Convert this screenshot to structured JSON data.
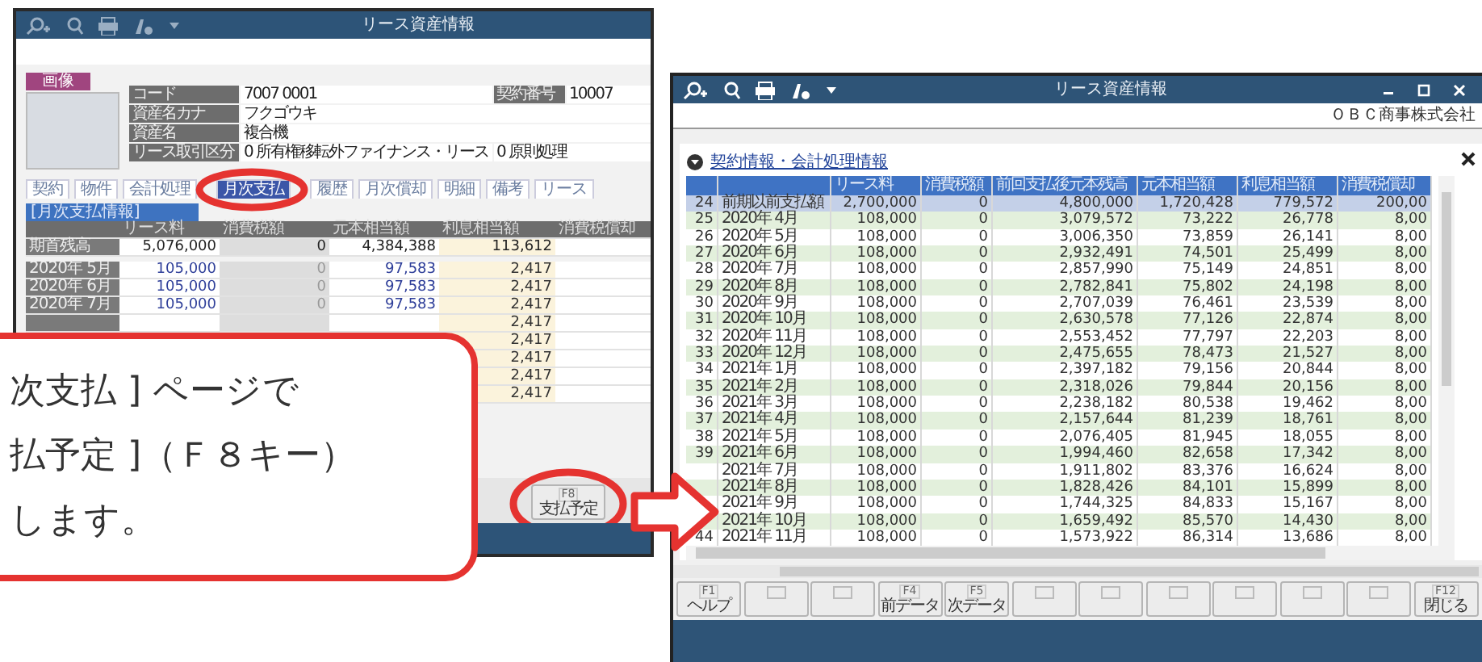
{
  "back_window": {
    "title": "リース資産情報",
    "photo_tag": "画像",
    "fields": [
      {
        "label": "コード",
        "value": "7007 0001"
      },
      {
        "label": "契約番号",
        "value": "10007"
      },
      {
        "label": "資産名カナ",
        "value": "フクゴウキ"
      },
      {
        "label": "資産名",
        "value": "複合機"
      },
      {
        "label": "リース取引区分",
        "value": "0 所有権移転外ファイナンス・リース"
      },
      {
        "value": "0 原則処理"
      }
    ],
    "tabs": [
      {
        "label": "契約",
        "selected": false
      },
      {
        "label": "物件",
        "selected": false
      },
      {
        "label": "会計処理",
        "selected": false
      },
      {
        "label": "月次支払",
        "selected": true
      },
      {
        "label": "履歴",
        "selected": false
      },
      {
        "label": "月次償却",
        "selected": false
      },
      {
        "label": "明細",
        "selected": false
      },
      {
        "label": "備考",
        "selected": false
      },
      {
        "label": "リース",
        "selected": false
      }
    ],
    "section": "[月次支払情報]",
    "table": {
      "columns": [
        "リース料",
        "消費税額",
        "元本相当額",
        "利息相当額",
        "消費税償却"
      ],
      "opening": {
        "label": "期首残高",
        "cells": [
          "5,076,000",
          "0",
          "4,384,388",
          "113,612"
        ]
      },
      "rows": [
        {
          "label": "2020年 5月",
          "cells": [
            "105,000",
            "0",
            "97,583",
            "2,417"
          ]
        },
        {
          "label": "2020年 6月",
          "cells": [
            "105,000",
            "0",
            "97,583",
            "2,417"
          ]
        },
        {
          "label": "2020年 7月",
          "cells": [
            "105,000",
            "0",
            "97,583",
            "2,417"
          ]
        },
        {
          "cells": [
            "2,417"
          ]
        },
        {
          "cells": [
            "2,417"
          ]
        },
        {
          "cells": [
            "2,417"
          ]
        },
        {
          "cells": [
            "2,417"
          ]
        },
        {
          "cells": [
            "2,417"
          ]
        }
      ]
    },
    "function_key": {
      "kind": "key",
      "key": "F8",
      "label": "支払予定"
    }
  },
  "front_window": {
    "title": "リース資産情報",
    "company": "ＯＢＣ商事株式会社",
    "section": "契約情報・会計処理情報",
    "table": {
      "columns": [
        "リース料",
        "消費税額",
        "前回支払後元本残高",
        "元本相当額",
        "利息相当額",
        "消費税償却"
      ],
      "rows": [
        {
          "number": "24",
          "label": "前期以前支払額",
          "cells": [
            "2,700,000",
            "0",
            "4,800,000",
            "1,720,428",
            "779,572",
            "200,00"
          ],
          "selected": true
        },
        {
          "number": "25",
          "label": "2020年 4月",
          "cells": [
            "108,000",
            "0",
            "3,079,572",
            "73,222",
            "26,778",
            "8,00"
          ],
          "selected": false
        },
        {
          "number": "26",
          "label": "2020年 5月",
          "cells": [
            "108,000",
            "0",
            "3,006,350",
            "73,859",
            "26,141",
            "8,00"
          ],
          "selected": false
        },
        {
          "number": "27",
          "label": "2020年 6月",
          "cells": [
            "108,000",
            "0",
            "2,932,491",
            "74,501",
            "25,499",
            "8,00"
          ],
          "selected": false
        },
        {
          "number": "28",
          "label": "2020年 7月",
          "cells": [
            "108,000",
            "0",
            "2,857,990",
            "75,149",
            "24,851",
            "8,00"
          ],
          "selected": false
        },
        {
          "number": "29",
          "label": "2020年 8月",
          "cells": [
            "108,000",
            "0",
            "2,782,841",
            "75,802",
            "24,198",
            "8,00"
          ],
          "selected": false
        },
        {
          "number": "30",
          "label": "2020年 9月",
          "cells": [
            "108,000",
            "0",
            "2,707,039",
            "76,461",
            "23,539",
            "8,00"
          ],
          "selected": false
        },
        {
          "number": "31",
          "label": "2020年 10月",
          "cells": [
            "108,000",
            "0",
            "2,630,578",
            "77,126",
            "22,874",
            "8,00"
          ],
          "selected": false
        },
        {
          "number": "32",
          "label": "2020年 11月",
          "cells": [
            "108,000",
            "0",
            "2,553,452",
            "77,797",
            "22,203",
            "8,00"
          ],
          "selected": false
        },
        {
          "number": "33",
          "label": "2020年 12月",
          "cells": [
            "108,000",
            "0",
            "2,475,655",
            "78,473",
            "21,527",
            "8,00"
          ],
          "selected": false
        },
        {
          "number": "34",
          "label": "2021年 1月",
          "cells": [
            "108,000",
            "0",
            "2,397,182",
            "79,156",
            "20,844",
            "8,00"
          ],
          "selected": false
        },
        {
          "number": "35",
          "label": "2021年 2月",
          "cells": [
            "108,000",
            "0",
            "2,318,026",
            "79,844",
            "20,156",
            "8,00"
          ],
          "selected": false
        },
        {
          "number": "36",
          "label": "2021年 3月",
          "cells": [
            "108,000",
            "0",
            "2,238,182",
            "80,538",
            "19,462",
            "8,00"
          ],
          "selected": false
        },
        {
          "number": "37",
          "label": "2021年 4月",
          "cells": [
            "108,000",
            "0",
            "2,157,644",
            "81,239",
            "18,761",
            "8,00"
          ],
          "selected": false
        },
        {
          "number": "38",
          "label": "2021年 5月",
          "cells": [
            "108,000",
            "0",
            "2,076,405",
            "81,945",
            "18,055",
            "8,00"
          ],
          "selected": false
        },
        {
          "number": "39",
          "label": "2021年 6月",
          "cells": [
            "108,000",
            "0",
            "1,994,460",
            "82,658",
            "17,342",
            "8,00"
          ],
          "selected": false
        },
        {
          "label": "2021年 7月",
          "cells": [
            "108,000",
            "0",
            "1,911,802",
            "83,376",
            "16,624",
            "8,00"
          ],
          "selected": false
        },
        {
          "label": "2021年 8月",
          "cells": [
            "108,000",
            "0",
            "1,828,426",
            "84,101",
            "15,899",
            "8,00"
          ],
          "selected": false
        },
        {
          "label": "2021年 9月",
          "cells": [
            "108,000",
            "0",
            "1,744,325",
            "84,833",
            "15,167",
            "8,00"
          ],
          "selected": false
        },
        {
          "label": "2021年 10月",
          "cells": [
            "108,000",
            "0",
            "1,659,492",
            "85,570",
            "14,430",
            "8,00"
          ],
          "selected": false
        },
        {
          "number": "44",
          "label": "2021年 11月",
          "cells": [
            "108,000",
            "0",
            "1,573,922",
            "86,314",
            "13,686",
            "8,00"
          ],
          "selected": false
        }
      ]
    },
    "function_keys": [
      {
        "kind": "key",
        "key": "F1",
        "label": "ヘルプ"
      },
      {
        "kind": "blank"
      },
      {
        "kind": "blank"
      },
      {
        "kind": "key",
        "key": "F4",
        "label": "前データ"
      },
      {
        "kind": "key",
        "key": "F5",
        "label": "次データ"
      },
      {
        "kind": "blank"
      },
      {
        "kind": "blank"
      },
      {
        "kind": "blank"
      },
      {
        "kind": "blank"
      },
      {
        "kind": "blank"
      },
      {
        "kind": "blank"
      },
      {
        "kind": "key",
        "key": "F12",
        "label": "閉じる"
      }
    ]
  },
  "callout": {
    "lines": [
      "次支払 ] ページで",
      "払予定 ]（Ｆ８キー）",
      "します。"
    ]
  }
}
